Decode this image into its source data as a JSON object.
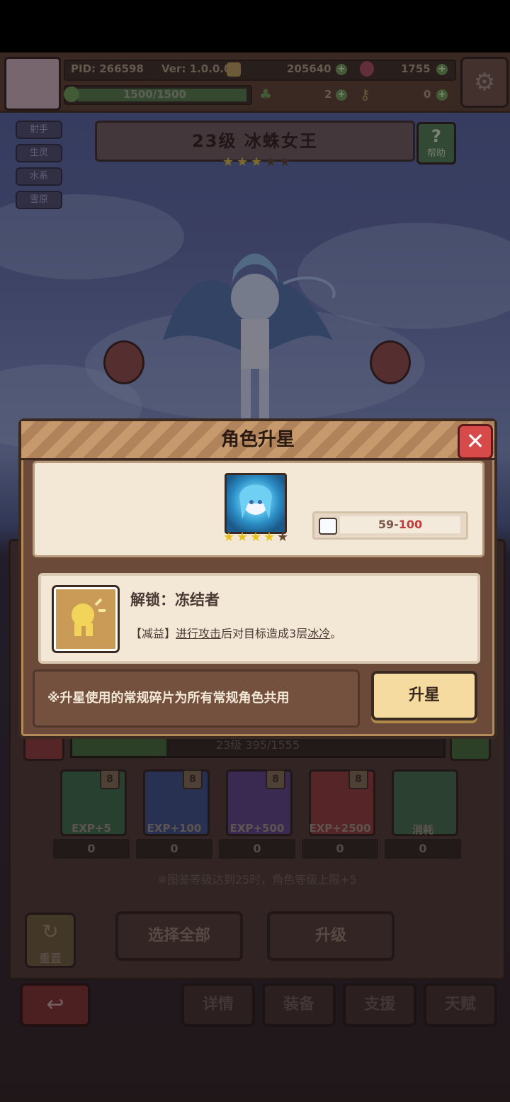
{
  "topbar": {
    "pid": "PID: 266598",
    "version": "Ver: 1.0.0.0",
    "gold": "205640",
    "gems": "1755",
    "stamina": "1500/1500",
    "clover": "2",
    "keys": "0"
  },
  "tags": [
    "射手",
    "生灵",
    "水系",
    "雪原"
  ],
  "character": {
    "title": "23级  冰蛛女王",
    "stars_filled": 3,
    "stars_total": 5,
    "help_label": "帮助"
  },
  "modal": {
    "title": "角色升星",
    "shards_current": "59-",
    "shards_required": "100",
    "icon_stars_filled": 4,
    "icon_stars_total": 5,
    "unlock_title": "解锁：冻结者",
    "desc_prefix": "【减益】",
    "desc_link1": "进行攻击",
    "desc_mid": "后对目标造成3层",
    "desc_link2": "冰冷",
    "desc_end": "。",
    "note": "※升星使用的常规碎片为所有常规角色共用",
    "upgrade_button": "升星"
  },
  "level_bar": {
    "text": "23级 395/1555",
    "progress": 0.254
  },
  "exp_items": [
    {
      "label": "EXP+5",
      "count": "0",
      "badge": "8",
      "color": "#3a6a4a"
    },
    {
      "label": "EXP+100",
      "count": "0",
      "badge": "8",
      "color": "#3a4f86"
    },
    {
      "label": "EXP+500",
      "count": "0",
      "badge": "8",
      "color": "#5a4286"
    },
    {
      "label": "EXP+2500",
      "count": "0",
      "badge": "8",
      "color": "#8a3a3a"
    },
    {
      "label": "消耗",
      "count": "0",
      "badge": "",
      "color": "#3e6a4a"
    }
  ],
  "note_level": "※图鉴等级达到25时，角色等级上限+5",
  "buttons": {
    "reset": "重置",
    "select_all": "选择全部",
    "level_up": "升级"
  },
  "tabs": [
    "详情",
    "装备",
    "支援",
    "天赋"
  ]
}
